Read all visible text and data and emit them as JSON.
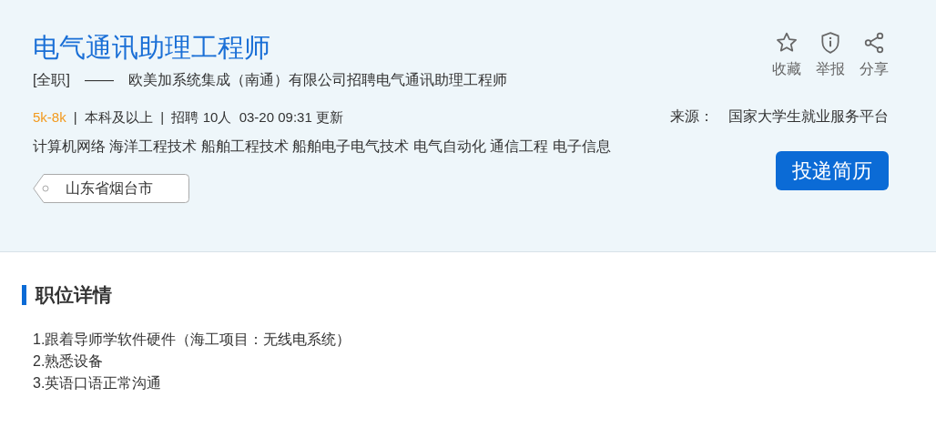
{
  "job": {
    "title": "电气通讯助理工程师",
    "type": "[全职]",
    "dash": "——",
    "subtitle": "欧美加系统集成（南通）有限公司招聘电气通讯助理工程师",
    "salary": "5k-8k",
    "meta": "|  本科及以上  |  招聘 10人  03-20 09:31 更新",
    "majors": "计算机网络 海洋工程技术 船舶工程技术 船舶电子电气技术 电气自动化 通信工程 电子信息",
    "location": "山东省烟台市"
  },
  "actions": [
    {
      "kind": "star",
      "label": "收藏"
    },
    {
      "kind": "shield",
      "label": "举报"
    },
    {
      "kind": "share",
      "label": "分享"
    }
  ],
  "source": {
    "label": "来源：",
    "value": "国家大学生就业服务平台"
  },
  "apply_button": "投递简历",
  "details": {
    "heading": "职位详情",
    "lines": [
      "1.跟着导师学软件硬件（海工项目：无线电系统）",
      "2.熟悉设备",
      "3.英语口语正常沟通"
    ]
  }
}
